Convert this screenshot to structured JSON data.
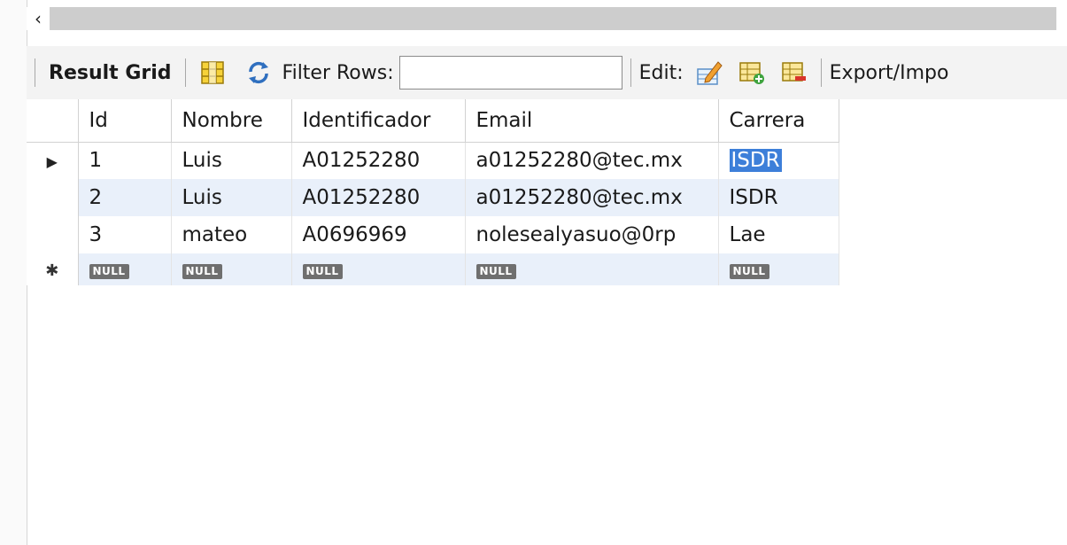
{
  "scrollbar": {
    "left_arrow": "‹"
  },
  "toolbar": {
    "result_grid_label": "Result Grid",
    "filter_label": "Filter Rows:",
    "filter_value": "",
    "edit_label": "Edit:",
    "export_label": "Export/Impo"
  },
  "grid": {
    "columns": [
      "Id",
      "Nombre",
      "Identificador",
      "Email",
      "Carrera"
    ],
    "rows": [
      [
        "1",
        "Luis",
        "A01252280",
        "a01252280@tec.mx",
        "ISDR"
      ],
      [
        "2",
        "Luis",
        "A01252280",
        "a01252280@tec.mx",
        "ISDR"
      ],
      [
        "3",
        "mateo",
        "A0696969",
        "nolesealyasuo@0rp",
        "Lae"
      ]
    ],
    "null_label": "NULL",
    "current_row_marker": "▶",
    "new_row_marker": "✱"
  },
  "colors": {
    "selection": "#3d7fd9",
    "alt_row": "#e9f0fa",
    "null_badge": "#6f6f6f"
  }
}
